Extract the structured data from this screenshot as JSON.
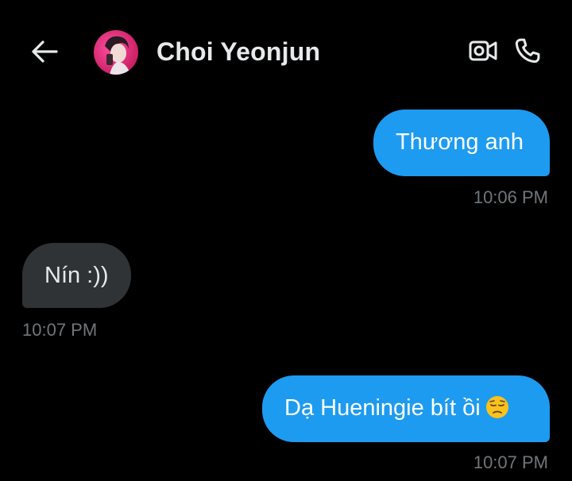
{
  "header": {
    "contact_name": "Choi Yeonjun",
    "icons": {
      "back": "arrow-left-icon",
      "video": "video-camera-icon",
      "call": "phone-icon"
    }
  },
  "colors": {
    "background": "#000000",
    "outgoing_bubble": "#1d9bf0",
    "incoming_bubble": "#2f3336",
    "timestamp": "#71767b",
    "text": "#e7e9ea"
  },
  "messages": [
    {
      "direction": "outgoing",
      "text": "Thương anh",
      "time": "10:06 PM"
    },
    {
      "direction": "incoming",
      "text": "Nín :))",
      "time": "10:07 PM"
    },
    {
      "direction": "outgoing",
      "text": "Dạ Hueningie bít ồi",
      "emoji": "pensive-face-icon",
      "time": "10:07 PM"
    }
  ]
}
